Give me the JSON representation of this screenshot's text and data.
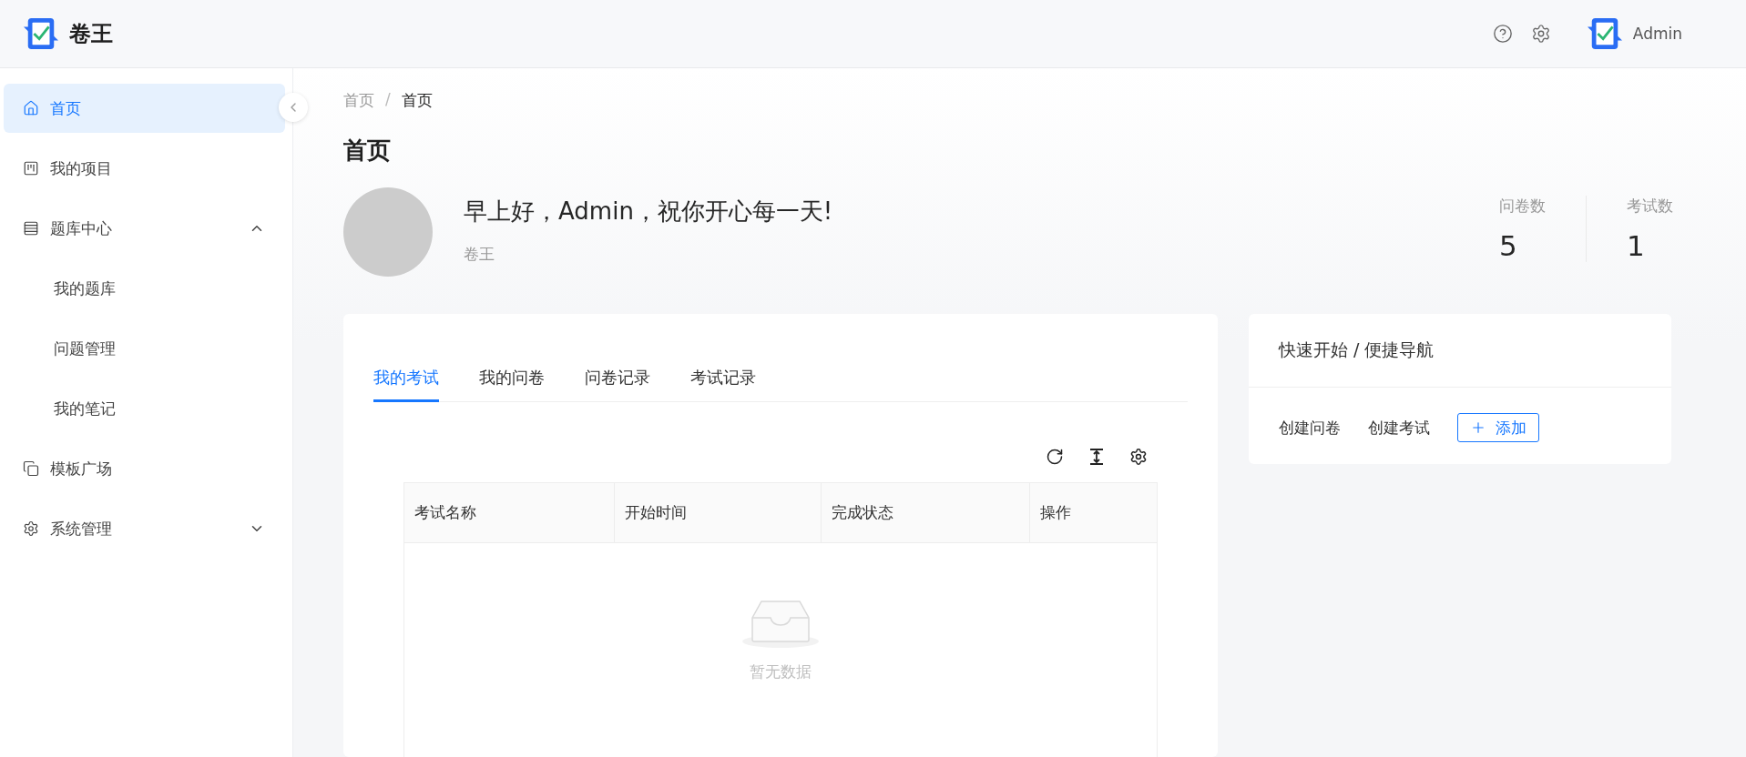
{
  "header": {
    "app_name": "卷王",
    "user": "Admin"
  },
  "sidebar": {
    "items": [
      {
        "label": "首页",
        "selected": true
      },
      {
        "label": "我的项目",
        "selected": false
      },
      {
        "label": "题库中心",
        "selected": false,
        "expanded": true,
        "children": [
          {
            "label": "我的题库",
            "selected": false
          },
          {
            "label": "问题管理",
            "selected": false
          },
          {
            "label": "我的笔记",
            "selected": false
          }
        ]
      },
      {
        "label": "模板广场",
        "selected": false
      },
      {
        "label": "系统管理",
        "selected": false,
        "expanded": false
      }
    ]
  },
  "breadcrumb": {
    "items": [
      "首页",
      "首页"
    ],
    "separator": "/"
  },
  "page_title": "首页",
  "greeting": "早上好，Admin，祝你开心每一天!",
  "subtitle": "卷王",
  "stats": [
    {
      "label": "问卷数",
      "value": "5"
    },
    {
      "label": "考试数",
      "value": "1"
    }
  ],
  "tabs": [
    {
      "label": "我的考试",
      "selected": true
    },
    {
      "label": "我的问卷",
      "selected": false
    },
    {
      "label": "问卷记录",
      "selected": false
    },
    {
      "label": "考试记录",
      "selected": false
    }
  ],
  "table": {
    "columns": [
      "考试名称",
      "开始时间",
      "完成状态",
      "操作"
    ],
    "empty_text": "暂无数据"
  },
  "quick_nav": {
    "title": "快速开始 / 便捷导航",
    "links": [
      "创建问卷",
      "创建考试"
    ],
    "add_button": "添加"
  }
}
